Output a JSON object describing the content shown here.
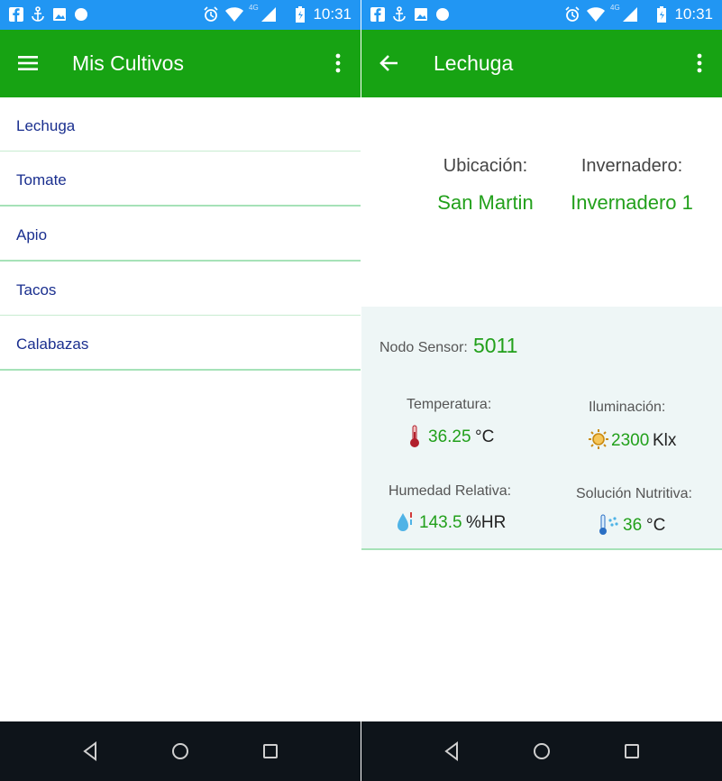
{
  "status_bar": {
    "time": "10:31",
    "network": "4G"
  },
  "left": {
    "title": "Mis Cultivos",
    "crops": [
      {
        "label": "Lechuga"
      },
      {
        "label": "Tomate"
      },
      {
        "label": "Apio"
      },
      {
        "label": "Tacos"
      },
      {
        "label": "Calabazas"
      }
    ]
  },
  "right": {
    "title": "Lechuga",
    "location_label": "Ubicación:",
    "location_value": "San Martin",
    "greenhouse_label": "Invernadero:",
    "greenhouse_value": "Invernadero 1",
    "sensor": {
      "node_label": "Nodo Sensor:",
      "node_value": "5011",
      "temperature": {
        "label": "Temperatura:",
        "value": "36.25",
        "unit": "°C"
      },
      "illumination": {
        "label": "Iluminación:",
        "value": "2300",
        "unit": "Klx"
      },
      "humidity": {
        "label": "Humedad Relativa:",
        "value": "143.5",
        "unit": "%HR"
      },
      "nutrient": {
        "label": "Solución Nutritiva:",
        "value": "36",
        "unit": "°C"
      }
    }
  },
  "colors": {
    "status_bar": "#2196f3",
    "app_bar": "#17a313",
    "value_green": "#22a01b",
    "list_text": "#1a2f8f",
    "nav_bar": "#0e141a",
    "sensor_card": "#eef6f6"
  },
  "icons": [
    "facebook-icon",
    "anchor-icon",
    "image-icon",
    "circle-icon",
    "alarm-icon",
    "wifi-icon",
    "signal-icon",
    "battery-icon",
    "menu-icon",
    "overflow-icon",
    "back-arrow-icon",
    "thermometer-icon",
    "sun-icon",
    "droplet-icon",
    "nutrient-icon",
    "nav-back-icon",
    "nav-home-icon",
    "nav-recents-icon"
  ]
}
